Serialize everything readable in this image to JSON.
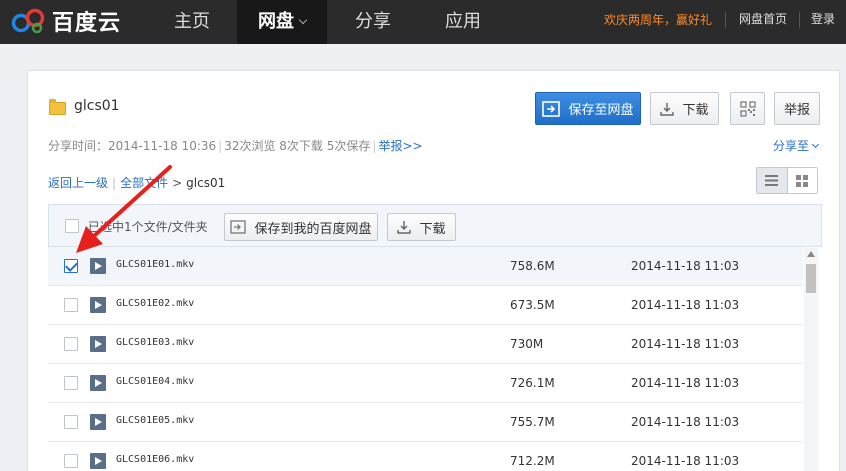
{
  "brand": {
    "name": "百度云"
  },
  "nav": {
    "home": "主页",
    "pan": "网盘",
    "share": "分享",
    "app": "应用",
    "promo": "欢庆两周年，赢好礼",
    "pan_home": "网盘首页",
    "login": "登录"
  },
  "folder": {
    "title": "glcs01",
    "save_button": "保存至网盘",
    "download_button": "下载",
    "report_button": "举报"
  },
  "meta": {
    "share_time": "分享时间：2014-11-18 10:36",
    "views": "32次浏览",
    "downloads": "8次下载",
    "saves": "5次保存",
    "report": "举报>>",
    "share_to": "分享至"
  },
  "breadcrumb": {
    "back": "返回上一级",
    "all": "全部文件",
    "current": "glcs01"
  },
  "toolbar": {
    "selected_text": "已选中1个文件/文件夹",
    "save_to_pan": "保存到我的百度网盘",
    "download": "下载"
  },
  "files": [
    {
      "name": "GLCS01E01.mkv",
      "size": "758.6M",
      "date": "2014-11-18 11:03",
      "checked": true
    },
    {
      "name": "GLCS01E02.mkv",
      "size": "673.5M",
      "date": "2014-11-18 11:03",
      "checked": false
    },
    {
      "name": "GLCS01E03.mkv",
      "size": "730M",
      "date": "2014-11-18 11:03",
      "checked": false
    },
    {
      "name": "GLCS01E04.mkv",
      "size": "726.1M",
      "date": "2014-11-18 11:03",
      "checked": false
    },
    {
      "name": "GLCS01E05.mkv",
      "size": "755.7M",
      "date": "2014-11-18 11:03",
      "checked": false
    },
    {
      "name": "GLCS01E06.mkv",
      "size": "712.2M",
      "date": "2014-11-18 11:03",
      "checked": false
    }
  ],
  "colors": {
    "primary": "#1f6ec9",
    "link": "#2a6fc9",
    "promo": "#ff8a2a",
    "annotation": "#e8201c"
  },
  "icons": {
    "logo": "cloud-logo-icon",
    "save": "save-to-cloud-icon",
    "download": "download-icon",
    "qr": "qrcode-icon",
    "list_view": "list-view-icon",
    "grid_view": "grid-view-icon",
    "video": "video-file-icon",
    "annotation": "red-arrow-icon"
  }
}
